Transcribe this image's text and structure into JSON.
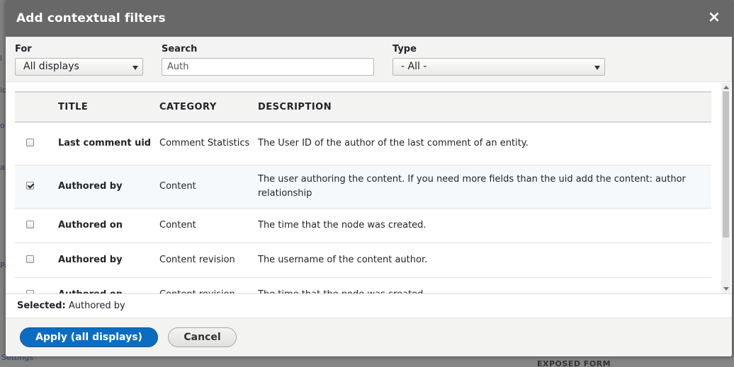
{
  "background": {
    "left_fragments": [
      "l",
      "id",
      "o",
      "a",
      "Pa"
    ],
    "settings_link": "Settings",
    "exposed_form": "EXPOSED FORM"
  },
  "dialog": {
    "title": "Add contextual filters",
    "close_label": "×"
  },
  "filters": {
    "for_label": "For",
    "for_value": "All displays",
    "search_label": "Search",
    "search_value": "Auth",
    "type_label": "Type",
    "type_value": "- All -"
  },
  "table": {
    "headers": [
      "TITLE",
      "CATEGORY",
      "DESCRIPTION"
    ],
    "rows": [
      {
        "checked": false,
        "title": "Last comment uid",
        "category": "Comment Statistics",
        "description": "The User ID of the author of the last comment of an entity."
      },
      {
        "checked": true,
        "title": "Authored by",
        "category": "Content",
        "description": "The user authoring the content. If you need more fields than the uid add the content: author relationship"
      },
      {
        "checked": false,
        "title": "Authored on",
        "category": "Content",
        "description": "The time that the node was created."
      },
      {
        "checked": false,
        "title": "Authored by",
        "category": "Content revision",
        "description": "The username of the content author."
      },
      {
        "checked": false,
        "title": "Authored on",
        "category": "Content revision",
        "description": "The time that the node was created."
      }
    ]
  },
  "selected": {
    "label": "Selected:",
    "value": "Authored by"
  },
  "buttons": {
    "apply_label": "Apply (all displays)",
    "cancel_label": "Cancel"
  },
  "colors": {
    "titlebar": "#686868",
    "primary_button": "#0b6dc2",
    "filter_bar": "#f3f3f1"
  }
}
